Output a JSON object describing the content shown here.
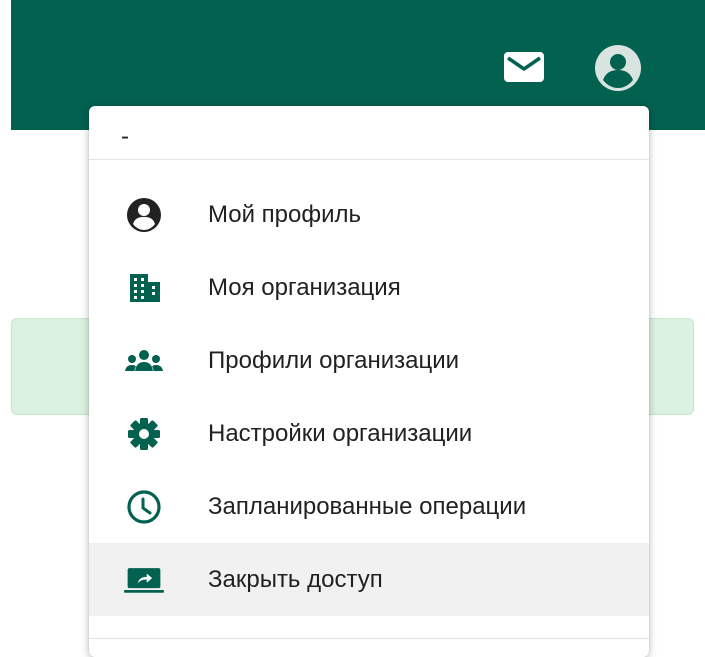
{
  "colors": {
    "app_bar": "#02614f",
    "accent": "#02614f",
    "panel": "#dbf1e1",
    "menu_hover": "#f1f1f1"
  },
  "header": {
    "mail_icon": "mail-icon",
    "account_icon": "account-circle-icon"
  },
  "menu": {
    "user_name": "-",
    "items": [
      {
        "label": "Мой профиль",
        "icon": "account-circle-icon"
      },
      {
        "label": "Моя организация",
        "icon": "building-icon"
      },
      {
        "label": "Профили организации",
        "icon": "people-icon"
      },
      {
        "label": "Настройки организации",
        "icon": "gear-icon"
      },
      {
        "label": "Запланированные операции",
        "icon": "clock-icon"
      },
      {
        "label": "Закрыть доступ",
        "icon": "screen-share-icon"
      }
    ]
  }
}
